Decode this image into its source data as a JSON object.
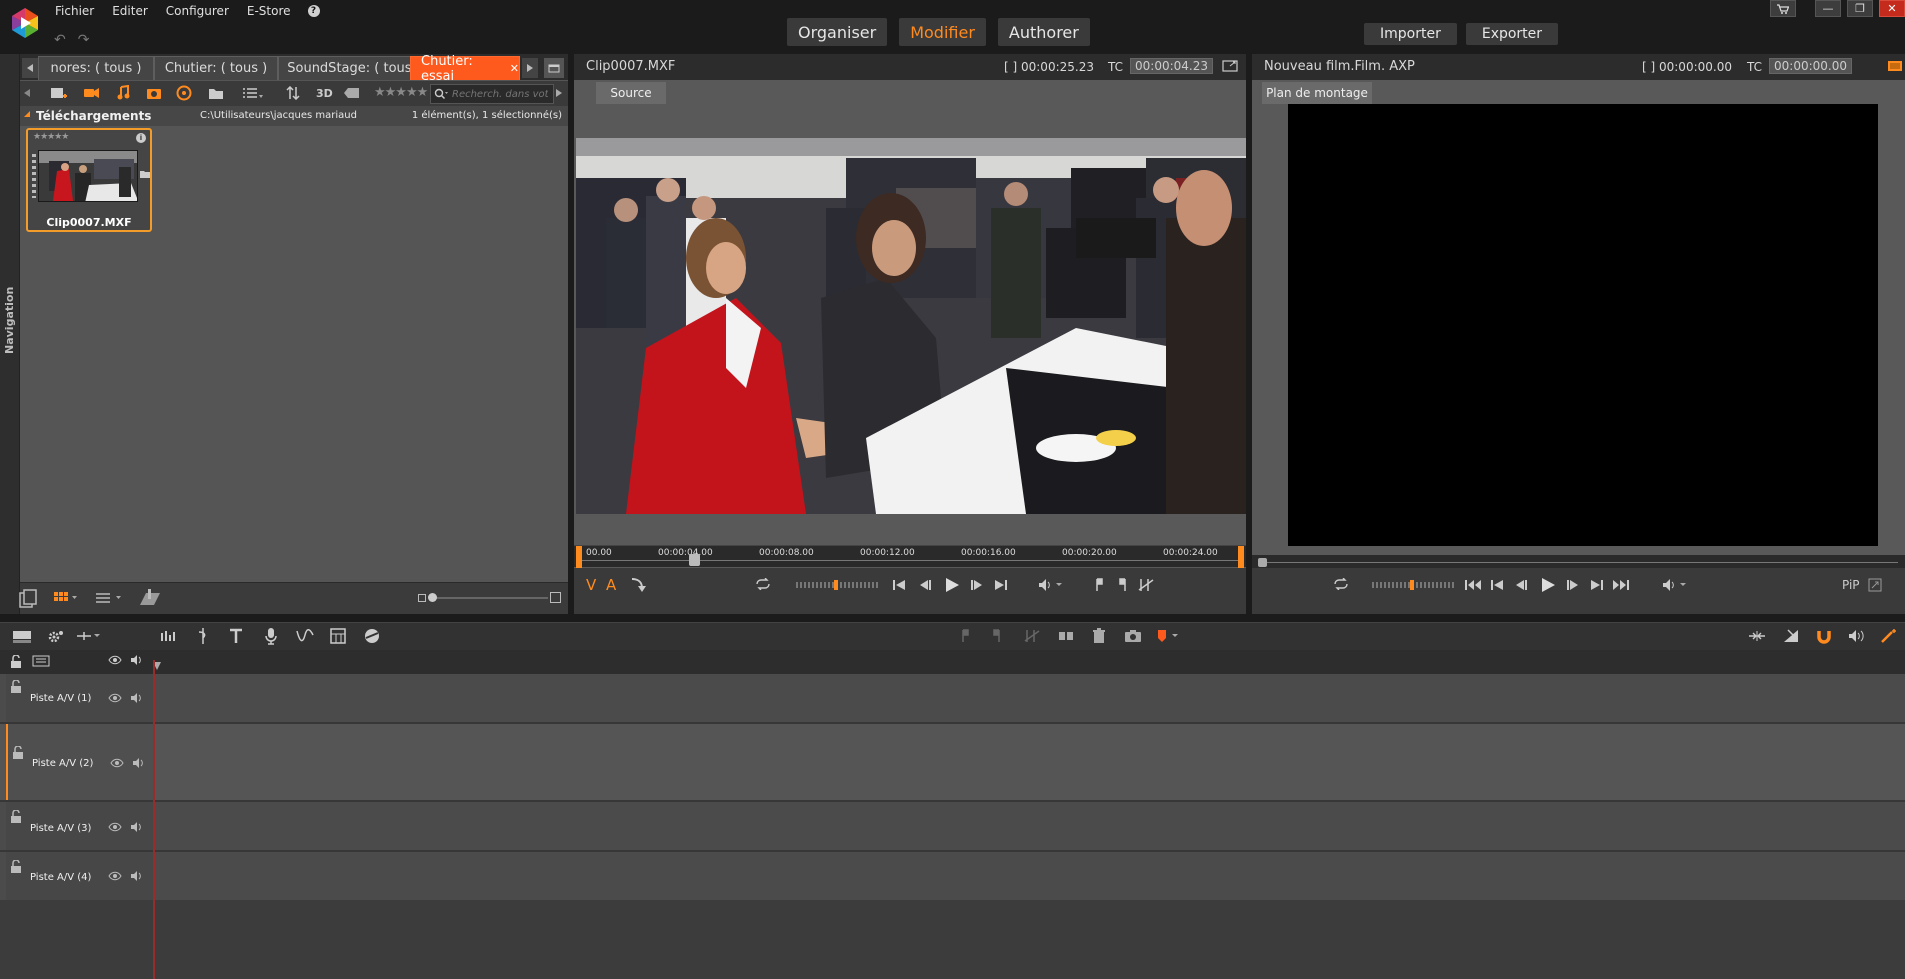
{
  "menu": {
    "items": [
      "Fichier",
      "Editer",
      "Configurer",
      "E-Store"
    ],
    "help": "?"
  },
  "modes": [
    {
      "label": "Organiser",
      "active": false
    },
    {
      "label": "Modifier",
      "active": true
    },
    {
      "label": "Authorer",
      "active": false
    }
  ],
  "import_label": "Importer",
  "export_label": "Exporter",
  "library": {
    "tabs": [
      {
        "label": "nores: ( tous )",
        "active": false
      },
      {
        "label": "Chutier: ( tous )",
        "active": false
      },
      {
        "label": "SoundStage: ( tous )",
        "active": false
      },
      {
        "label": "Chutier: essai",
        "active": true
      }
    ],
    "search_placeholder": "Recherch. dans vot",
    "three_d": "3D",
    "folder": "Téléchargements",
    "path": "C:\\Utilisateurs\\jacques mariaud",
    "selection_info": "1 élément(s), 1 sélectionné(s)",
    "nav_label": "Navigation",
    "clip": {
      "name": "Clip0007.MXF",
      "stars": "★★★★★"
    }
  },
  "source": {
    "clip_name": "Clip0007.MXF",
    "duration": "[ ] 00:00:25.23",
    "tc_label": "TC",
    "tc_value": "00:00:04.23",
    "tab": "Source",
    "ruler_ticks": [
      "00.00",
      "00:00:04.00",
      "00:00:08.00",
      "00:00:12.00",
      "00:00:16.00",
      "00:00:20.00",
      "00:00:24.00"
    ],
    "scrub_fraction": 0.17,
    "va_v": "V",
    "va_a": "A"
  },
  "film": {
    "title": "Nouveau film.Film. AXP",
    "duration": "[ ] 00:00:00.00",
    "tc_label": "TC",
    "tc_value": "00:00:00.00",
    "tab": "Plan de montage",
    "pip": "PiP"
  },
  "timeline": {
    "tracks": [
      {
        "name": "Piste A/V (1)"
      },
      {
        "name": "Piste A/V (2)"
      },
      {
        "name": "Piste A/V (3)"
      },
      {
        "name": "Piste A/V (4)"
      }
    ]
  },
  "colors": {
    "accent": "#ff8b1f",
    "active_tab": "#ff5a1e",
    "close": "#c42b1c"
  }
}
